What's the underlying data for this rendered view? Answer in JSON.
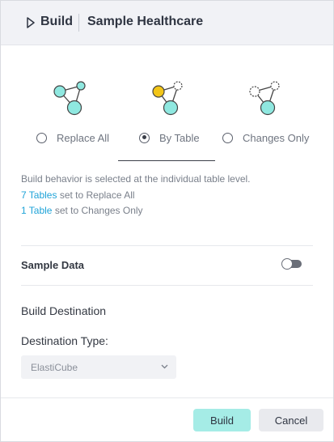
{
  "header": {
    "action_label": "Build",
    "model_name": "Sample Healthcare",
    "icon": "play-icon"
  },
  "build_options": [
    {
      "label": "Replace All",
      "selected": false,
      "icon": "replace-all-graph-icon"
    },
    {
      "label": "By Table",
      "selected": true,
      "icon": "by-table-graph-icon"
    },
    {
      "label": "Changes Only",
      "selected": false,
      "icon": "changes-only-graph-icon"
    }
  ],
  "description": {
    "line1": "Build behavior is selected at the individual table level.",
    "line2_link": "7 Tables",
    "line2_text": " set to Replace All",
    "line3_link": "1 Table",
    "line3_text": " set to Changes Only"
  },
  "sample_data": {
    "label": "Sample Data",
    "enabled": false
  },
  "destination": {
    "title": "Build Destination",
    "type_label": "Destination Type:",
    "selected": "ElastiCube"
  },
  "footer": {
    "build_label": "Build",
    "cancel_label": "Cancel"
  },
  "colors": {
    "accent": "#a5ece6",
    "node_teal": "#8fe8e0",
    "node_yellow": "#f2c518",
    "link": "#1fa3d8"
  }
}
